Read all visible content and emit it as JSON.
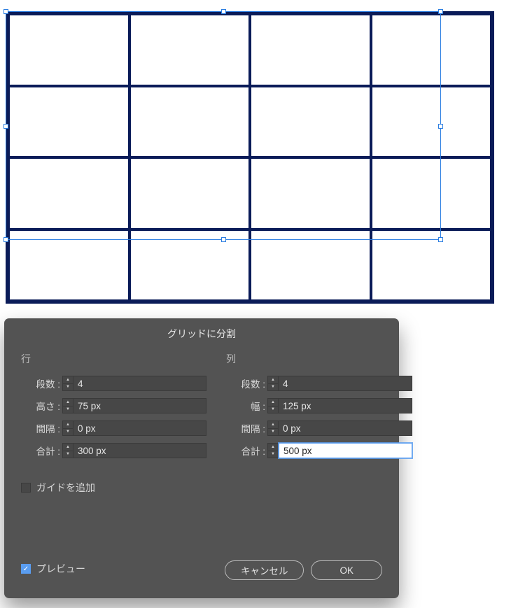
{
  "dialog": {
    "title": "グリッドに分割",
    "rows": {
      "header": "行",
      "count_label": "段数 :",
      "count_value": "4",
      "height_label": "高さ :",
      "height_value": "75 px",
      "gutter_label": "間隔 :",
      "gutter_value": "0 px",
      "total_label": "合計 :",
      "total_value": "300 px"
    },
    "cols": {
      "header": "列",
      "count_label": "段数 :",
      "count_value": "4",
      "width_label": "幅 :",
      "width_value": "125 px",
      "gutter_label": "間隔 :",
      "gutter_value": "0 px",
      "total_label": "合計 :",
      "total_value": "500 px"
    },
    "add_guides_label": "ガイドを追加",
    "preview_label": "プレビュー",
    "cancel_label": "キャンセル",
    "ok_label": "OK"
  },
  "grid": {
    "rows": 4,
    "cols": 4
  }
}
